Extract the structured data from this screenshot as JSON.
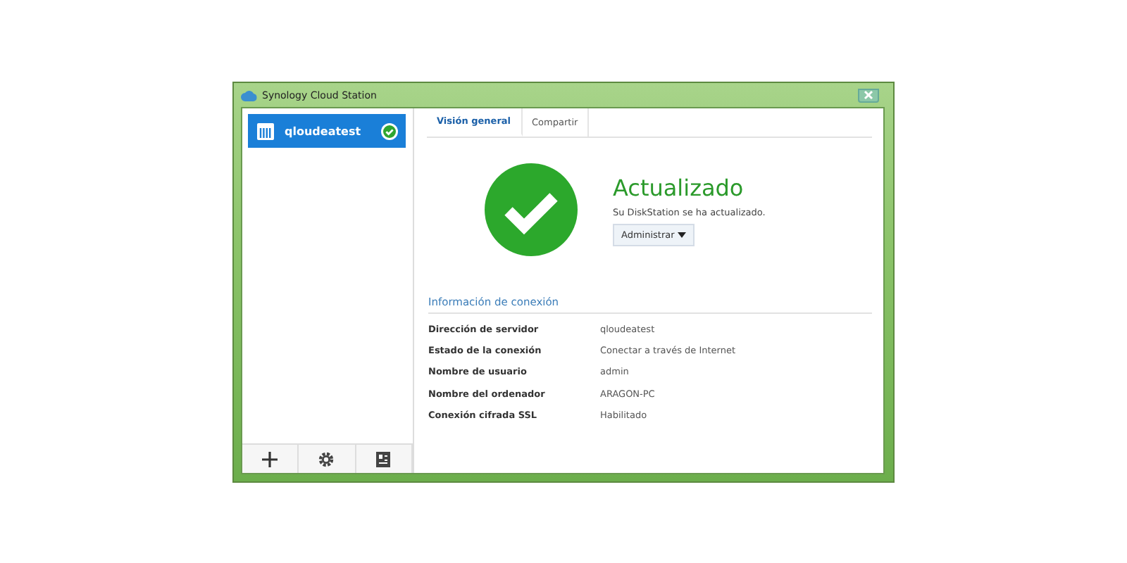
{
  "window": {
    "title": "Synology Cloud Station"
  },
  "sidebar": {
    "items": [
      {
        "label": "qloudeatest",
        "selected": true,
        "synced": true
      }
    ]
  },
  "tabs": [
    {
      "label": "Visión general",
      "selected": true
    },
    {
      "label": "Compartir",
      "selected": false
    }
  ],
  "status": {
    "title": "Actualizado",
    "message": "Su DiskStation se ha actualizado.",
    "button": "Administrar"
  },
  "connection": {
    "heading": "Información de conexión",
    "rows": [
      {
        "label": "Dirección de servidor",
        "value": "qloudeatest"
      },
      {
        "label": "Estado de la conexión",
        "value": "Conectar a través de Internet"
      },
      {
        "label": "Nombre de usuario",
        "value": "admin"
      },
      {
        "label": "Nombre del ordenador",
        "value": "ARAGON-PC"
      },
      {
        "label": "Conexión cifrada SSL",
        "value": "Habilitado"
      }
    ]
  }
}
